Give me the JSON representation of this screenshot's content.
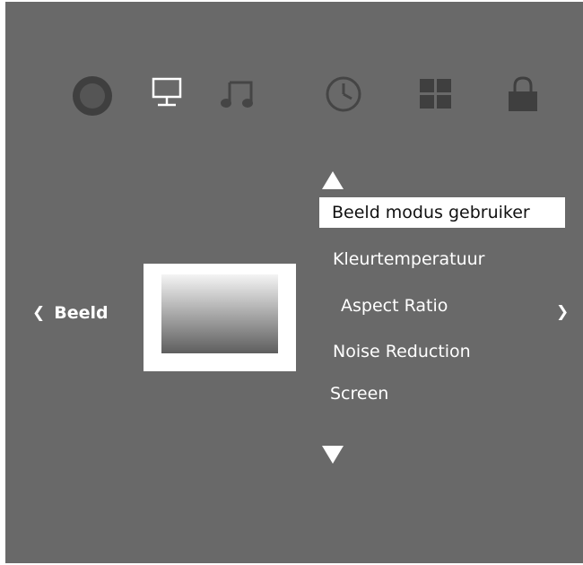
{
  "top_icons": [
    {
      "name": "picture-icon"
    },
    {
      "name": "display-icon"
    },
    {
      "name": "music-icon"
    },
    {
      "name": "clock-icon"
    },
    {
      "name": "apps-grid-icon"
    },
    {
      "name": "lock-icon"
    }
  ],
  "category": {
    "label": "Beeld",
    "prev_glyph": "❮",
    "next_glyph": "❯"
  },
  "menu": {
    "selected_index": 0,
    "items": [
      {
        "label": "Beeld modus gebruiker"
      },
      {
        "label": "Kleurtemperatuur"
      },
      {
        "label": "Aspect Ratio"
      },
      {
        "label": "Noise Reduction"
      },
      {
        "label": "Screen"
      }
    ]
  },
  "colors": {
    "frame": "#696969",
    "background": "#c3c3c3",
    "text": "#ffffff",
    "selected_bg": "#ffffff",
    "selected_text": "#111111",
    "icon_dark": "#454545",
    "icon_white": "#ffffff"
  }
}
